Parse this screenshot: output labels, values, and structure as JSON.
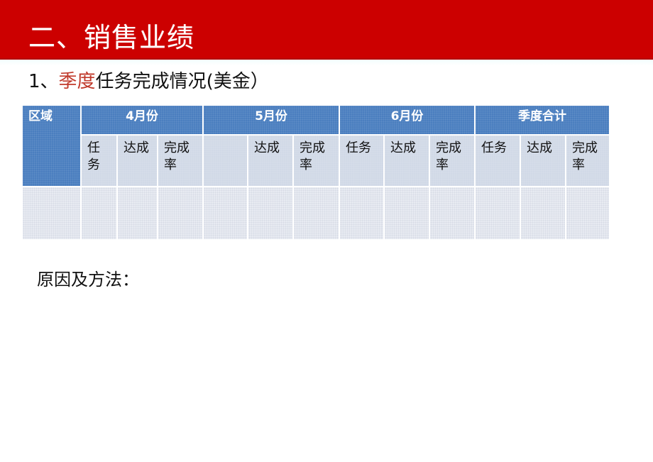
{
  "banner": {
    "title": "二、销售业绩",
    "color": "#cc0000"
  },
  "section": {
    "number": "1、",
    "highlight": "季度",
    "rest": "任务完成情况(美金）",
    "highlight_color": "#c0392b"
  },
  "table": {
    "region_header": "区域",
    "groups": [
      {
        "label": "4月份",
        "subs": [
          "任\n务",
          "达成",
          "完成\n率"
        ]
      },
      {
        "label": "5月份",
        "subs": [
          "",
          "达成",
          "完成\n率"
        ]
      },
      {
        "label": "6月份",
        "subs": [
          "任务",
          "达成",
          "完成\n率"
        ]
      },
      {
        "label": "季度合计",
        "subs": [
          "任务",
          "达成",
          "完成\n率"
        ]
      }
    ],
    "rows": [
      {
        "region": "",
        "values": [
          "",
          "",
          "",
          "",
          "",
          "",
          "",
          "",
          "",
          "",
          "",
          ""
        ]
      }
    ],
    "header_color": "#4a7ebf",
    "subheader_color": "#d1d9e7"
  },
  "reason": {
    "label": "原因及方法："
  }
}
